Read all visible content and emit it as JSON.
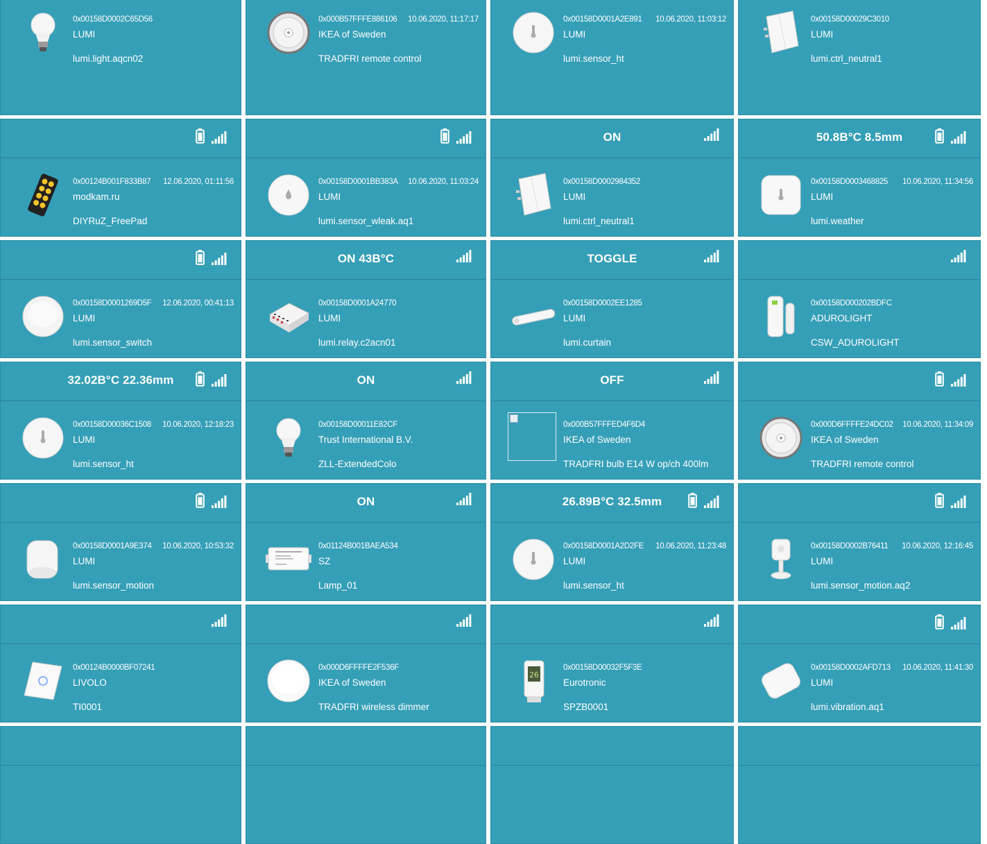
{
  "colors": {
    "card_bg": "#359fb7",
    "card_border": "#2d8ca1",
    "text": "#ffffff"
  },
  "devices": [
    {
      "state": "",
      "battery": false,
      "signal": false,
      "header": false,
      "ieee": "0x00158D0002C65D56",
      "timestamp": "",
      "manufacturer": "LUMI",
      "model": "lumi.light.aqcn02",
      "image": "bulb-icon"
    },
    {
      "state": "",
      "battery": false,
      "signal": false,
      "header": false,
      "ieee": "0x000B57FFFE886106",
      "timestamp": "10.06.2020, 11:17:17",
      "manufacturer": "IKEA of Sweden",
      "model": "TRADFRI remote control",
      "image": "round-remote-icon"
    },
    {
      "state": "",
      "battery": false,
      "signal": false,
      "header": false,
      "ieee": "0x00158D0001A2E891",
      "timestamp": "10.06.2020, 11:03:12",
      "manufacturer": "LUMI",
      "model": "lumi.sensor_ht",
      "image": "round-sensor-icon"
    },
    {
      "state": "",
      "battery": false,
      "signal": false,
      "header": false,
      "ieee": "0x00158D00029C3010",
      "timestamp": "",
      "manufacturer": "LUMI",
      "model": "lumi.ctrl_neutral1",
      "image": "wall-switch-icon"
    },
    {
      "state": "",
      "battery": true,
      "signal": true,
      "header": true,
      "ieee": "0x00124B001F833B87",
      "timestamp": "12.06.2020, 01:11:56",
      "manufacturer": "modkam.ru",
      "model": "DIYRuZ_FreePad",
      "image": "keypad-icon"
    },
    {
      "state": "",
      "battery": true,
      "signal": true,
      "header": true,
      "ieee": "0x00158D0001BB383A",
      "timestamp": "10.06.2020, 11:03:24",
      "manufacturer": "LUMI",
      "model": "lumi.sensor_wleak.aq1",
      "image": "water-leak-icon"
    },
    {
      "state": "ON",
      "battery": false,
      "signal": true,
      "header": true,
      "ieee": "0x00158D0002984352",
      "timestamp": "",
      "manufacturer": "LUMI",
      "model": "lumi.ctrl_neutral1",
      "image": "wall-switch-icon"
    },
    {
      "state": "50.8B°C 8.5mm",
      "battery": true,
      "signal": true,
      "header": true,
      "ieee": "0x00158D0003468825",
      "timestamp": "10.06.2020, 11:34:56",
      "manufacturer": "LUMI",
      "model": "lumi.weather",
      "image": "square-sensor-icon"
    },
    {
      "state": "",
      "battery": true,
      "signal": true,
      "header": true,
      "ieee": "0x00158D0001269D5F",
      "timestamp": "12.06.2020, 00:41:13",
      "manufacturer": "LUMI",
      "model": "lumi.sensor_switch",
      "image": "round-button-icon"
    },
    {
      "state": "ON 43B°C",
      "battery": false,
      "signal": true,
      "header": true,
      "ieee": "0x00158D0001A24770",
      "timestamp": "",
      "manufacturer": "LUMI",
      "model": "lumi.relay.c2acn01",
      "image": "relay-icon"
    },
    {
      "state": "TOGGLE",
      "battery": false,
      "signal": true,
      "header": true,
      "ieee": "0x00158D0002EE1285",
      "timestamp": "",
      "manufacturer": "LUMI",
      "model": "lumi.curtain",
      "image": "curtain-motor-icon"
    },
    {
      "state": "",
      "battery": false,
      "signal": true,
      "header": true,
      "ieee": "0x00158D000202BDFC",
      "timestamp": "",
      "manufacturer": "ADUROLIGHT",
      "model": "CSW_ADUROLIGHT",
      "image": "door-sensor-icon"
    },
    {
      "state": "32.02B°C 22.36mm",
      "battery": true,
      "signal": true,
      "header": true,
      "ieee": "0x00158D00036C1508",
      "timestamp": "10.06.2020, 12:18:23",
      "manufacturer": "LUMI",
      "model": "lumi.sensor_ht",
      "image": "round-sensor-icon"
    },
    {
      "state": "ON",
      "battery": false,
      "signal": true,
      "header": true,
      "ieee": "0x00158D00011E82CF",
      "timestamp": "",
      "manufacturer": "Trust International B.V.",
      "model": "ZLL-ExtendedColo",
      "image": "bulb-icon"
    },
    {
      "state": "OFF",
      "battery": false,
      "signal": true,
      "header": true,
      "ieee": "0x000B57FFFED4F6D4",
      "timestamp": "",
      "manufacturer": "IKEA of Sweden",
      "model": "TRADFRI bulb E14 W op/ch 400lm",
      "image": "broken-image-icon"
    },
    {
      "state": "",
      "battery": true,
      "signal": true,
      "header": true,
      "ieee": "0x000D6FFFFE24DC02",
      "timestamp": "10.06.2020, 11:34:09",
      "manufacturer": "IKEA of Sweden",
      "model": "TRADFRI remote control",
      "image": "round-remote-icon"
    },
    {
      "state": "",
      "battery": true,
      "signal": true,
      "header": true,
      "ieee": "0x00158D0001A9E374",
      "timestamp": "10.06.2020, 10:53:32",
      "manufacturer": "LUMI",
      "model": "lumi.sensor_motion",
      "image": "motion-sensor-icon"
    },
    {
      "state": "ON",
      "battery": false,
      "signal": true,
      "header": true,
      "ieee": "0x01124B001BAEA534",
      "timestamp": "",
      "manufacturer": "SZ",
      "model": "Lamp_01",
      "image": "led-controller-icon"
    },
    {
      "state": "26.89B°C 32.5mm",
      "battery": true,
      "signal": true,
      "header": true,
      "ieee": "0x00158D0001A2D2FE",
      "timestamp": "10.06.2020, 11:23:48",
      "manufacturer": "LUMI",
      "model": "lumi.sensor_ht",
      "image": "round-sensor-icon"
    },
    {
      "state": "",
      "battery": true,
      "signal": true,
      "header": true,
      "ieee": "0x00158D0002B76411",
      "timestamp": "10.06.2020, 12:16:45",
      "manufacturer": "LUMI",
      "model": "lumi.sensor_motion.aq2",
      "image": "motion-stand-icon"
    },
    {
      "state": "",
      "battery": false,
      "signal": true,
      "header": true,
      "ieee": "0x00124B0000BF07241",
      "timestamp": "",
      "manufacturer": "LIVOLO",
      "model": "TI0001",
      "image": "touch-switch-icon"
    },
    {
      "state": "",
      "battery": false,
      "signal": true,
      "header": true,
      "ieee": "0x000D6FFFFE2F536F",
      "timestamp": "",
      "manufacturer": "IKEA of Sweden",
      "model": "TRADFRI wireless dimmer",
      "image": "dimmer-icon"
    },
    {
      "state": "",
      "battery": false,
      "signal": true,
      "header": true,
      "ieee": "0x00158D00032F5F3E",
      "timestamp": "",
      "manufacturer": "Eurotronic",
      "model": "SPZB0001",
      "image": "thermostat-valve-icon"
    },
    {
      "state": "",
      "battery": true,
      "signal": true,
      "header": true,
      "ieee": "0x00158D0002AFD713",
      "timestamp": "10.06.2020, 11:41:30",
      "manufacturer": "LUMI",
      "model": "lumi.vibration.aq1",
      "image": "vibration-sensor-icon"
    },
    {
      "state": "",
      "battery": false,
      "signal": false,
      "header": true,
      "ieee": "",
      "timestamp": "",
      "manufacturer": "",
      "model": "",
      "image": ""
    },
    {
      "state": "",
      "battery": false,
      "signal": false,
      "header": true,
      "ieee": "",
      "timestamp": "",
      "manufacturer": "",
      "model": "",
      "image": ""
    },
    {
      "state": "",
      "battery": false,
      "signal": false,
      "header": true,
      "ieee": "",
      "timestamp": "",
      "manufacturer": "",
      "model": "",
      "image": ""
    },
    {
      "state": "",
      "battery": false,
      "signal": false,
      "header": true,
      "ieee": "",
      "timestamp": "",
      "manufacturer": "",
      "model": "",
      "image": ""
    }
  ]
}
